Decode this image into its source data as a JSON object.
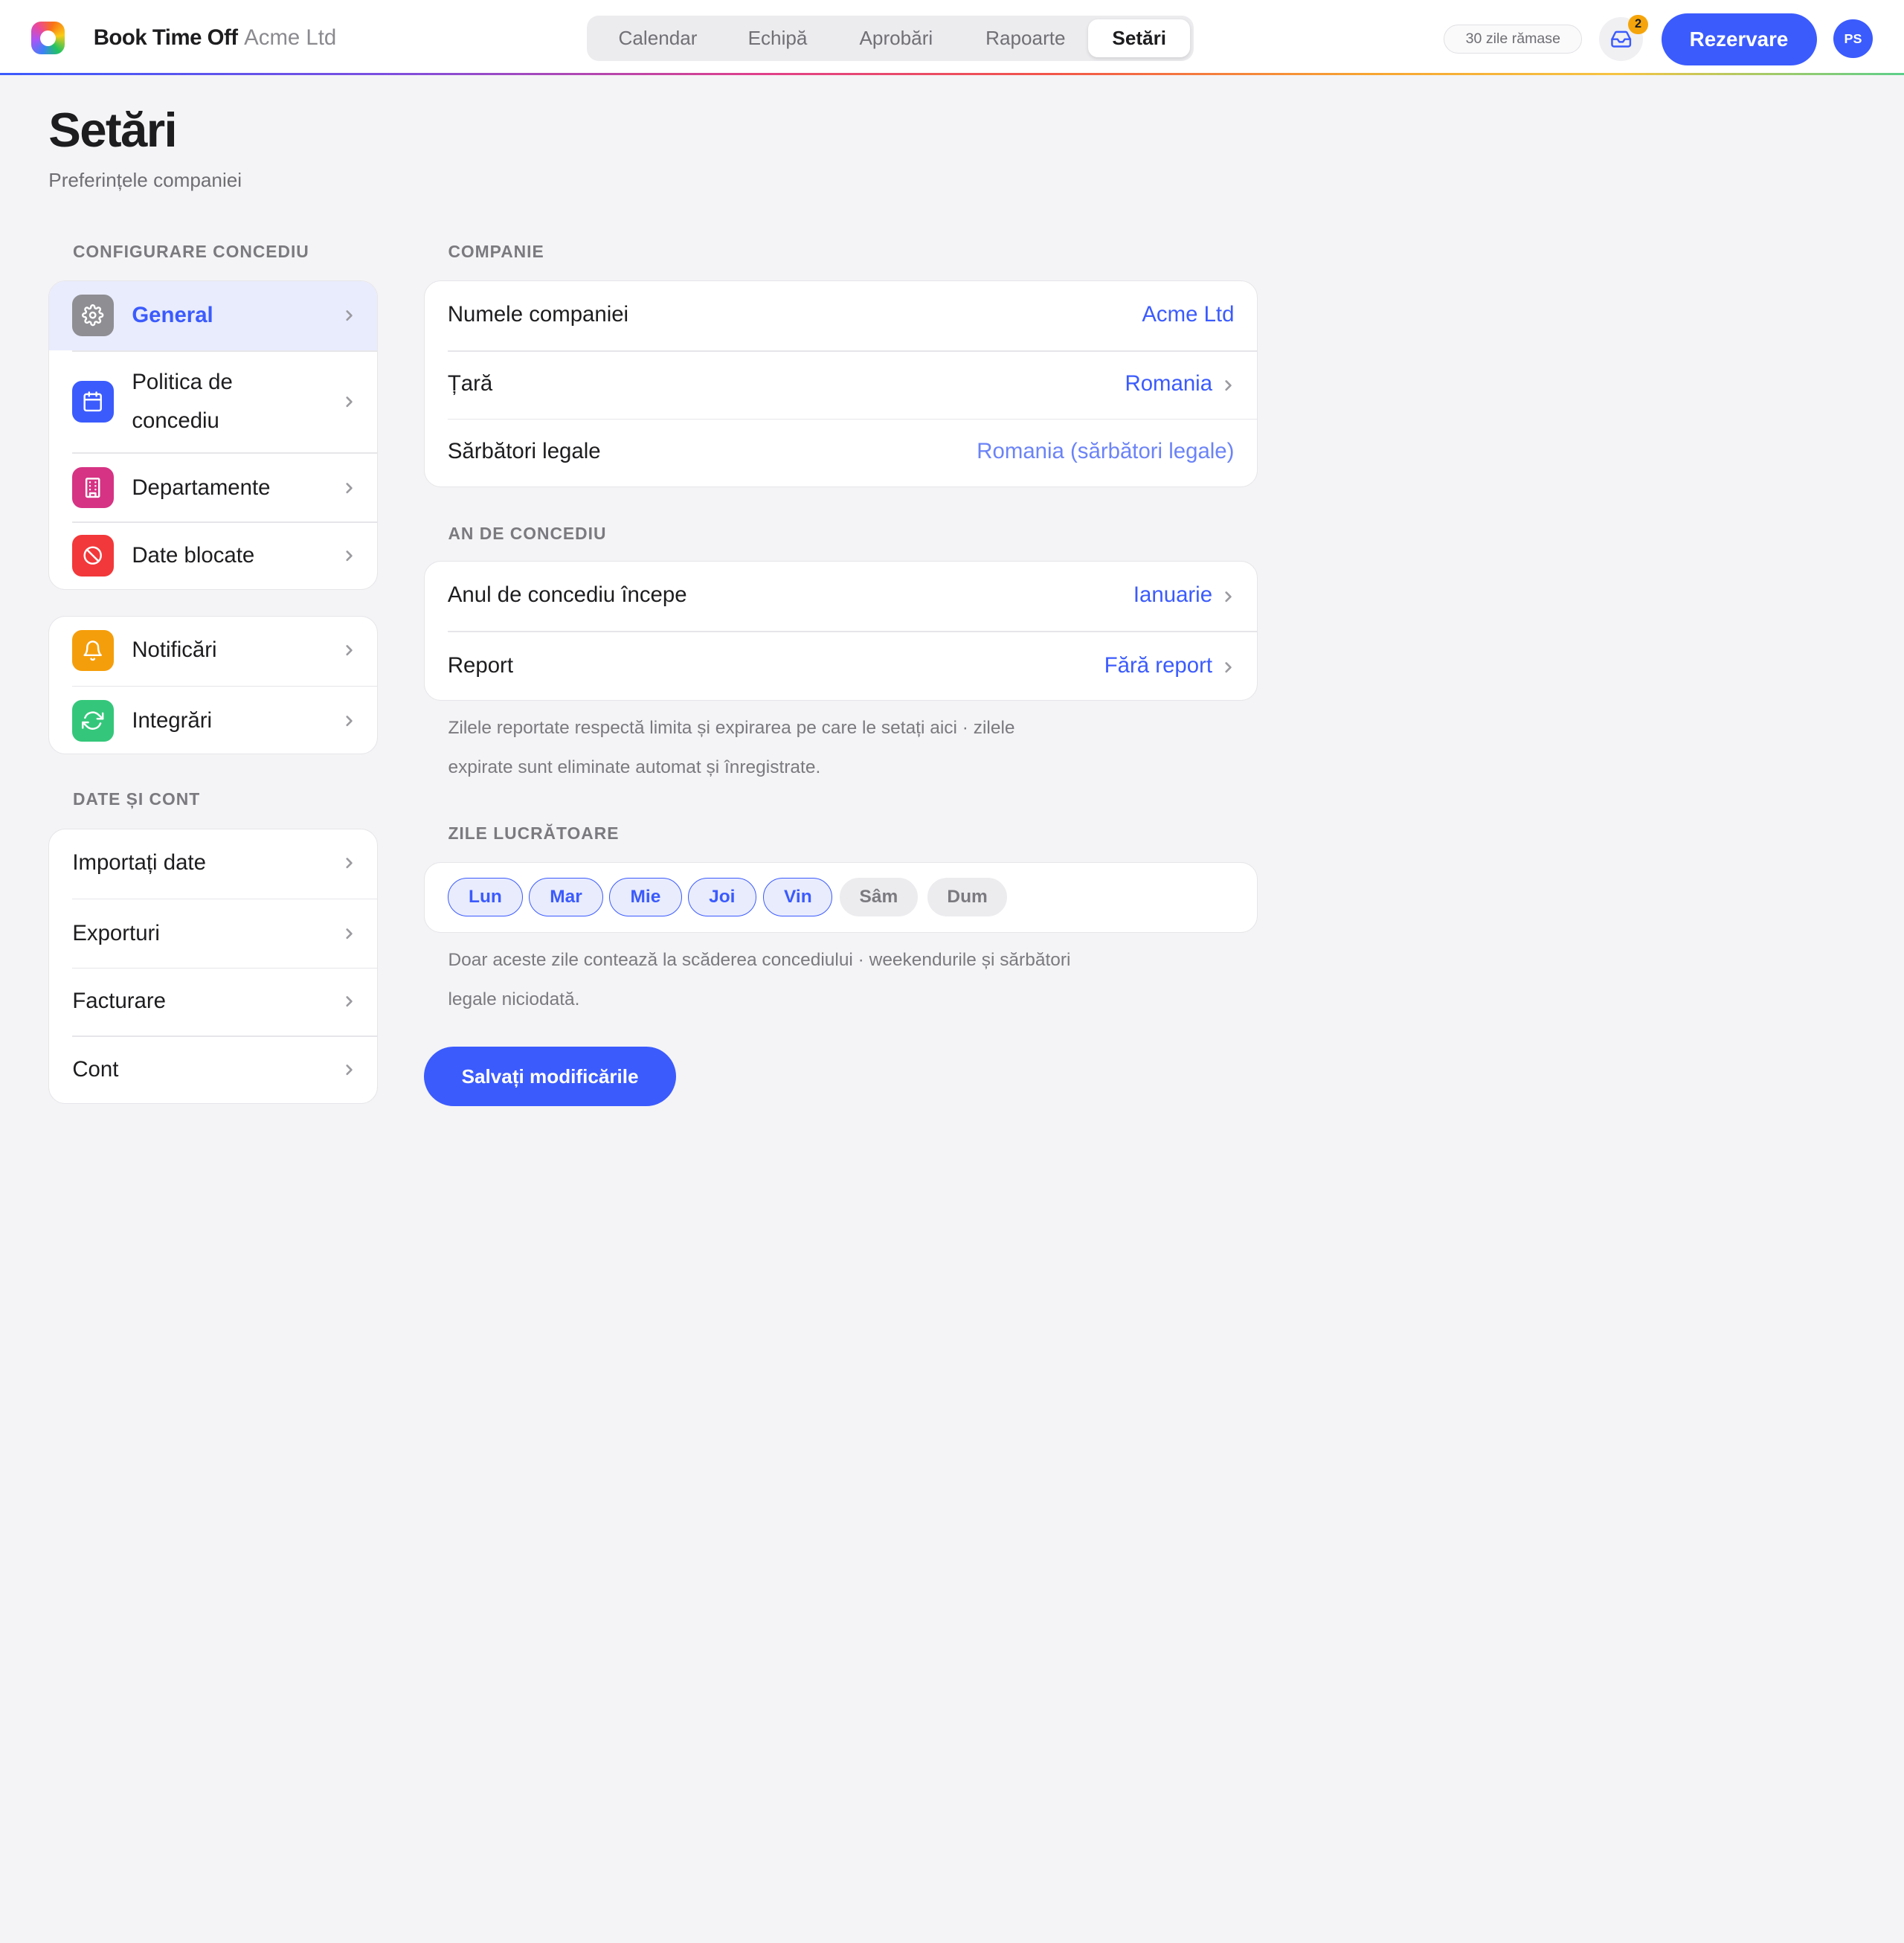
{
  "header": {
    "brand": "Book Time Off",
    "company": "Acme Ltd",
    "tabs": [
      {
        "label": "Calendar"
      },
      {
        "label": "Echipă"
      },
      {
        "label": "Aprobări"
      },
      {
        "label": "Rapoarte"
      },
      {
        "label": "Setări",
        "active": true
      }
    ],
    "days_left": "30 zile rămase",
    "inbox_count": "2",
    "book_label": "Rezervare",
    "avatar_initials": "PS"
  },
  "page": {
    "title": "Setări",
    "subtitle": "Preferințele companiei"
  },
  "sidebar": {
    "section_leave": "CONFIGURARE CONCEDIU",
    "leave_items": [
      {
        "label": "General",
        "icon": "gear-icon",
        "color": "#8e8e93",
        "active": true
      },
      {
        "label": "Politica de concediu",
        "label_line1": "Politica de",
        "label_line2": "concediu",
        "icon": "calendar-icon",
        "color": "#3b5bfd"
      },
      {
        "label": "Departamente",
        "icon": "building-icon",
        "color": "#d63384"
      },
      {
        "label": "Date blocate",
        "icon": "block-icon",
        "color": "#f2383a"
      }
    ],
    "other_items": [
      {
        "label": "Notificări",
        "icon": "bell-icon",
        "color": "#f59e0b"
      },
      {
        "label": "Integrări",
        "icon": "sync-icon",
        "color": "#34c77b"
      }
    ],
    "section_data": "DATE ȘI CONT",
    "data_items": [
      {
        "label": "Importați date"
      },
      {
        "label": "Exporturi"
      },
      {
        "label": "Facturare"
      },
      {
        "label": "Cont"
      }
    ]
  },
  "main": {
    "company_section": "COMPANIE",
    "company_rows": [
      {
        "key": "Numele companiei",
        "value": "Acme Ltd"
      },
      {
        "key": "Țară",
        "value": "Romania"
      },
      {
        "key": "Sărbători legale",
        "value": "Romania (sărbători legale)"
      }
    ],
    "leave_year_section": "AN DE CONCEDIU",
    "leave_year_rows": [
      {
        "key": "Anul de concediu începe",
        "value": "Ianuarie"
      },
      {
        "key": "Report",
        "value": "Fără report"
      }
    ],
    "carryover_help_line1": "Zilele reportate respectă limita și expirarea pe care le setați aici · zilele",
    "carryover_help_line2": "expirate sunt eliminate automat și înregistrate.",
    "workdays_section": "ZILE LUCRĂTOARE",
    "workdays": [
      {
        "label": "Lun",
        "on": true
      },
      {
        "label": "Mar",
        "on": true
      },
      {
        "label": "Mie",
        "on": true
      },
      {
        "label": "Joi",
        "on": true
      },
      {
        "label": "Vin",
        "on": true
      },
      {
        "label": "Sâm",
        "on": false
      },
      {
        "label": "Dum",
        "on": false
      }
    ],
    "workdays_help_line1": "Doar aceste zile contează la scăderea concediului · weekendurile și sărbători",
    "workdays_help_line2": "legale niciodată.",
    "save_label": "Salvați modificările"
  },
  "colors": {
    "accent": "#3b5bfd",
    "accent_soft": "#e9ecfd",
    "badge": "#f5a50b"
  }
}
